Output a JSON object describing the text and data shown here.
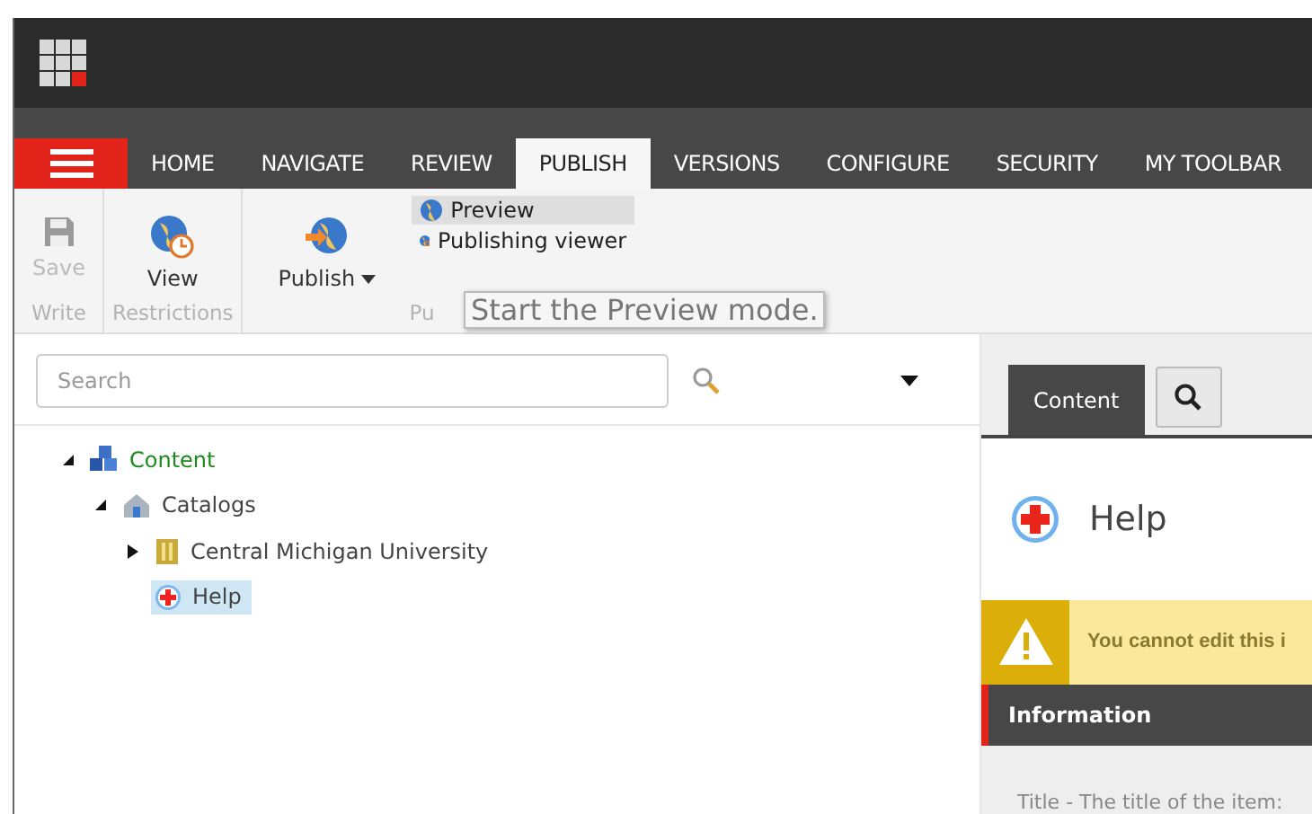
{
  "menu_button": {
    "kind": "hamburger"
  },
  "tabs": [
    {
      "label": "HOME",
      "selected": false
    },
    {
      "label": "NAVIGATE",
      "selected": false
    },
    {
      "label": "REVIEW",
      "selected": false
    },
    {
      "label": "PUBLISH",
      "selected": true
    },
    {
      "label": "VERSIONS",
      "selected": false
    },
    {
      "label": "CONFIGURE",
      "selected": false
    },
    {
      "label": "SECURITY",
      "selected": false
    },
    {
      "label": "MY TOOLBAR",
      "selected": false
    }
  ],
  "ribbon": {
    "groups": [
      {
        "label": "Write",
        "buttons": [
          {
            "kind": "save",
            "label": "Save",
            "disabled": true
          }
        ]
      },
      {
        "label": "Restrictions",
        "buttons": [
          {
            "kind": "view",
            "label": "View",
            "disabled": false
          }
        ]
      },
      {
        "label": "Pu",
        "buttons": [
          {
            "kind": "publish",
            "label": "Publish",
            "disabled": false
          }
        ],
        "small_buttons": [
          {
            "kind": "preview",
            "label": "Preview",
            "selected": true
          },
          {
            "kind": "viewer",
            "label": "Publishing viewer",
            "selected": false
          }
        ]
      }
    ]
  },
  "tooltip": "Start the Preview mode.",
  "search": {
    "placeholder": "Search"
  },
  "tree": [
    {
      "label": "Content",
      "kind": "content",
      "expanded": true,
      "selected": false,
      "children": [
        {
          "label": "Catalogs",
          "kind": "catalogs",
          "expanded": true,
          "selected": false,
          "children": [
            {
              "label": "Central Michigan University",
              "kind": "university",
              "has_children": true,
              "expanded": false,
              "selected": false
            },
            {
              "label": "Help",
              "kind": "help",
              "selected": true
            }
          ]
        }
      ]
    }
  ],
  "editor": {
    "tabs": [
      {
        "label": "Content",
        "selected": true
      }
    ],
    "title": "Help",
    "warning": "You cannot edit this i",
    "section": "Information",
    "field_label": "Title - The title of the item:"
  }
}
